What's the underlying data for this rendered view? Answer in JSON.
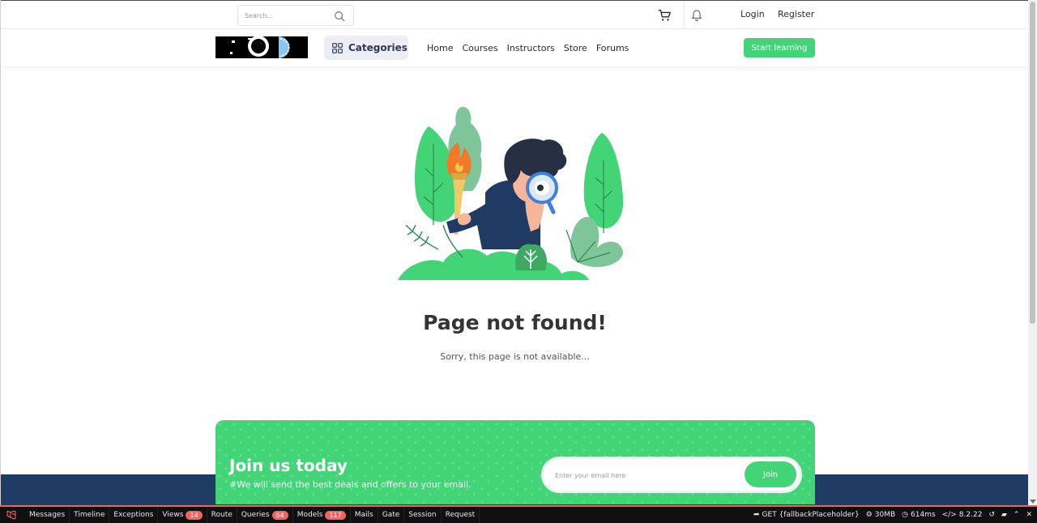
{
  "topbar": {
    "search_placeholder": "Search...",
    "login": "Login",
    "register": "Register"
  },
  "navbar": {
    "categories": "Categories",
    "links": [
      "Home",
      "Courses",
      "Instructors",
      "Store",
      "Forums"
    ],
    "start_learning": "Start learning"
  },
  "main": {
    "title": "Page not found!",
    "subtitle": "Sorry, this page is not available..."
  },
  "newsletter": {
    "title": "Join us today",
    "subtitle": "#We will send the best deals and offers to your email.",
    "email_placeholder": "Enter your email here",
    "join_label": "Join"
  },
  "debugbar": {
    "items": [
      {
        "label": "Messages"
      },
      {
        "label": "Timeline"
      },
      {
        "label": "Exceptions"
      },
      {
        "label": "Views",
        "badge": "14"
      },
      {
        "label": "Route"
      },
      {
        "label": "Queries",
        "badge": "64"
      },
      {
        "label": "Models",
        "badge": "117"
      },
      {
        "label": "Mails"
      },
      {
        "label": "Gate"
      },
      {
        "label": "Session"
      },
      {
        "label": "Request"
      }
    ],
    "request": "GET {fallbackPlaceholder}",
    "memory": "30MB",
    "time": "614ms",
    "php_version": "8.2.22"
  },
  "colors": {
    "primary_green": "#43d477",
    "dark_navy": "#1f3b64",
    "debug_red": "#f4645f"
  },
  "icons": {
    "search": "search-icon",
    "cart": "cart-icon",
    "bell": "bell-icon",
    "grid": "grid-icon"
  }
}
